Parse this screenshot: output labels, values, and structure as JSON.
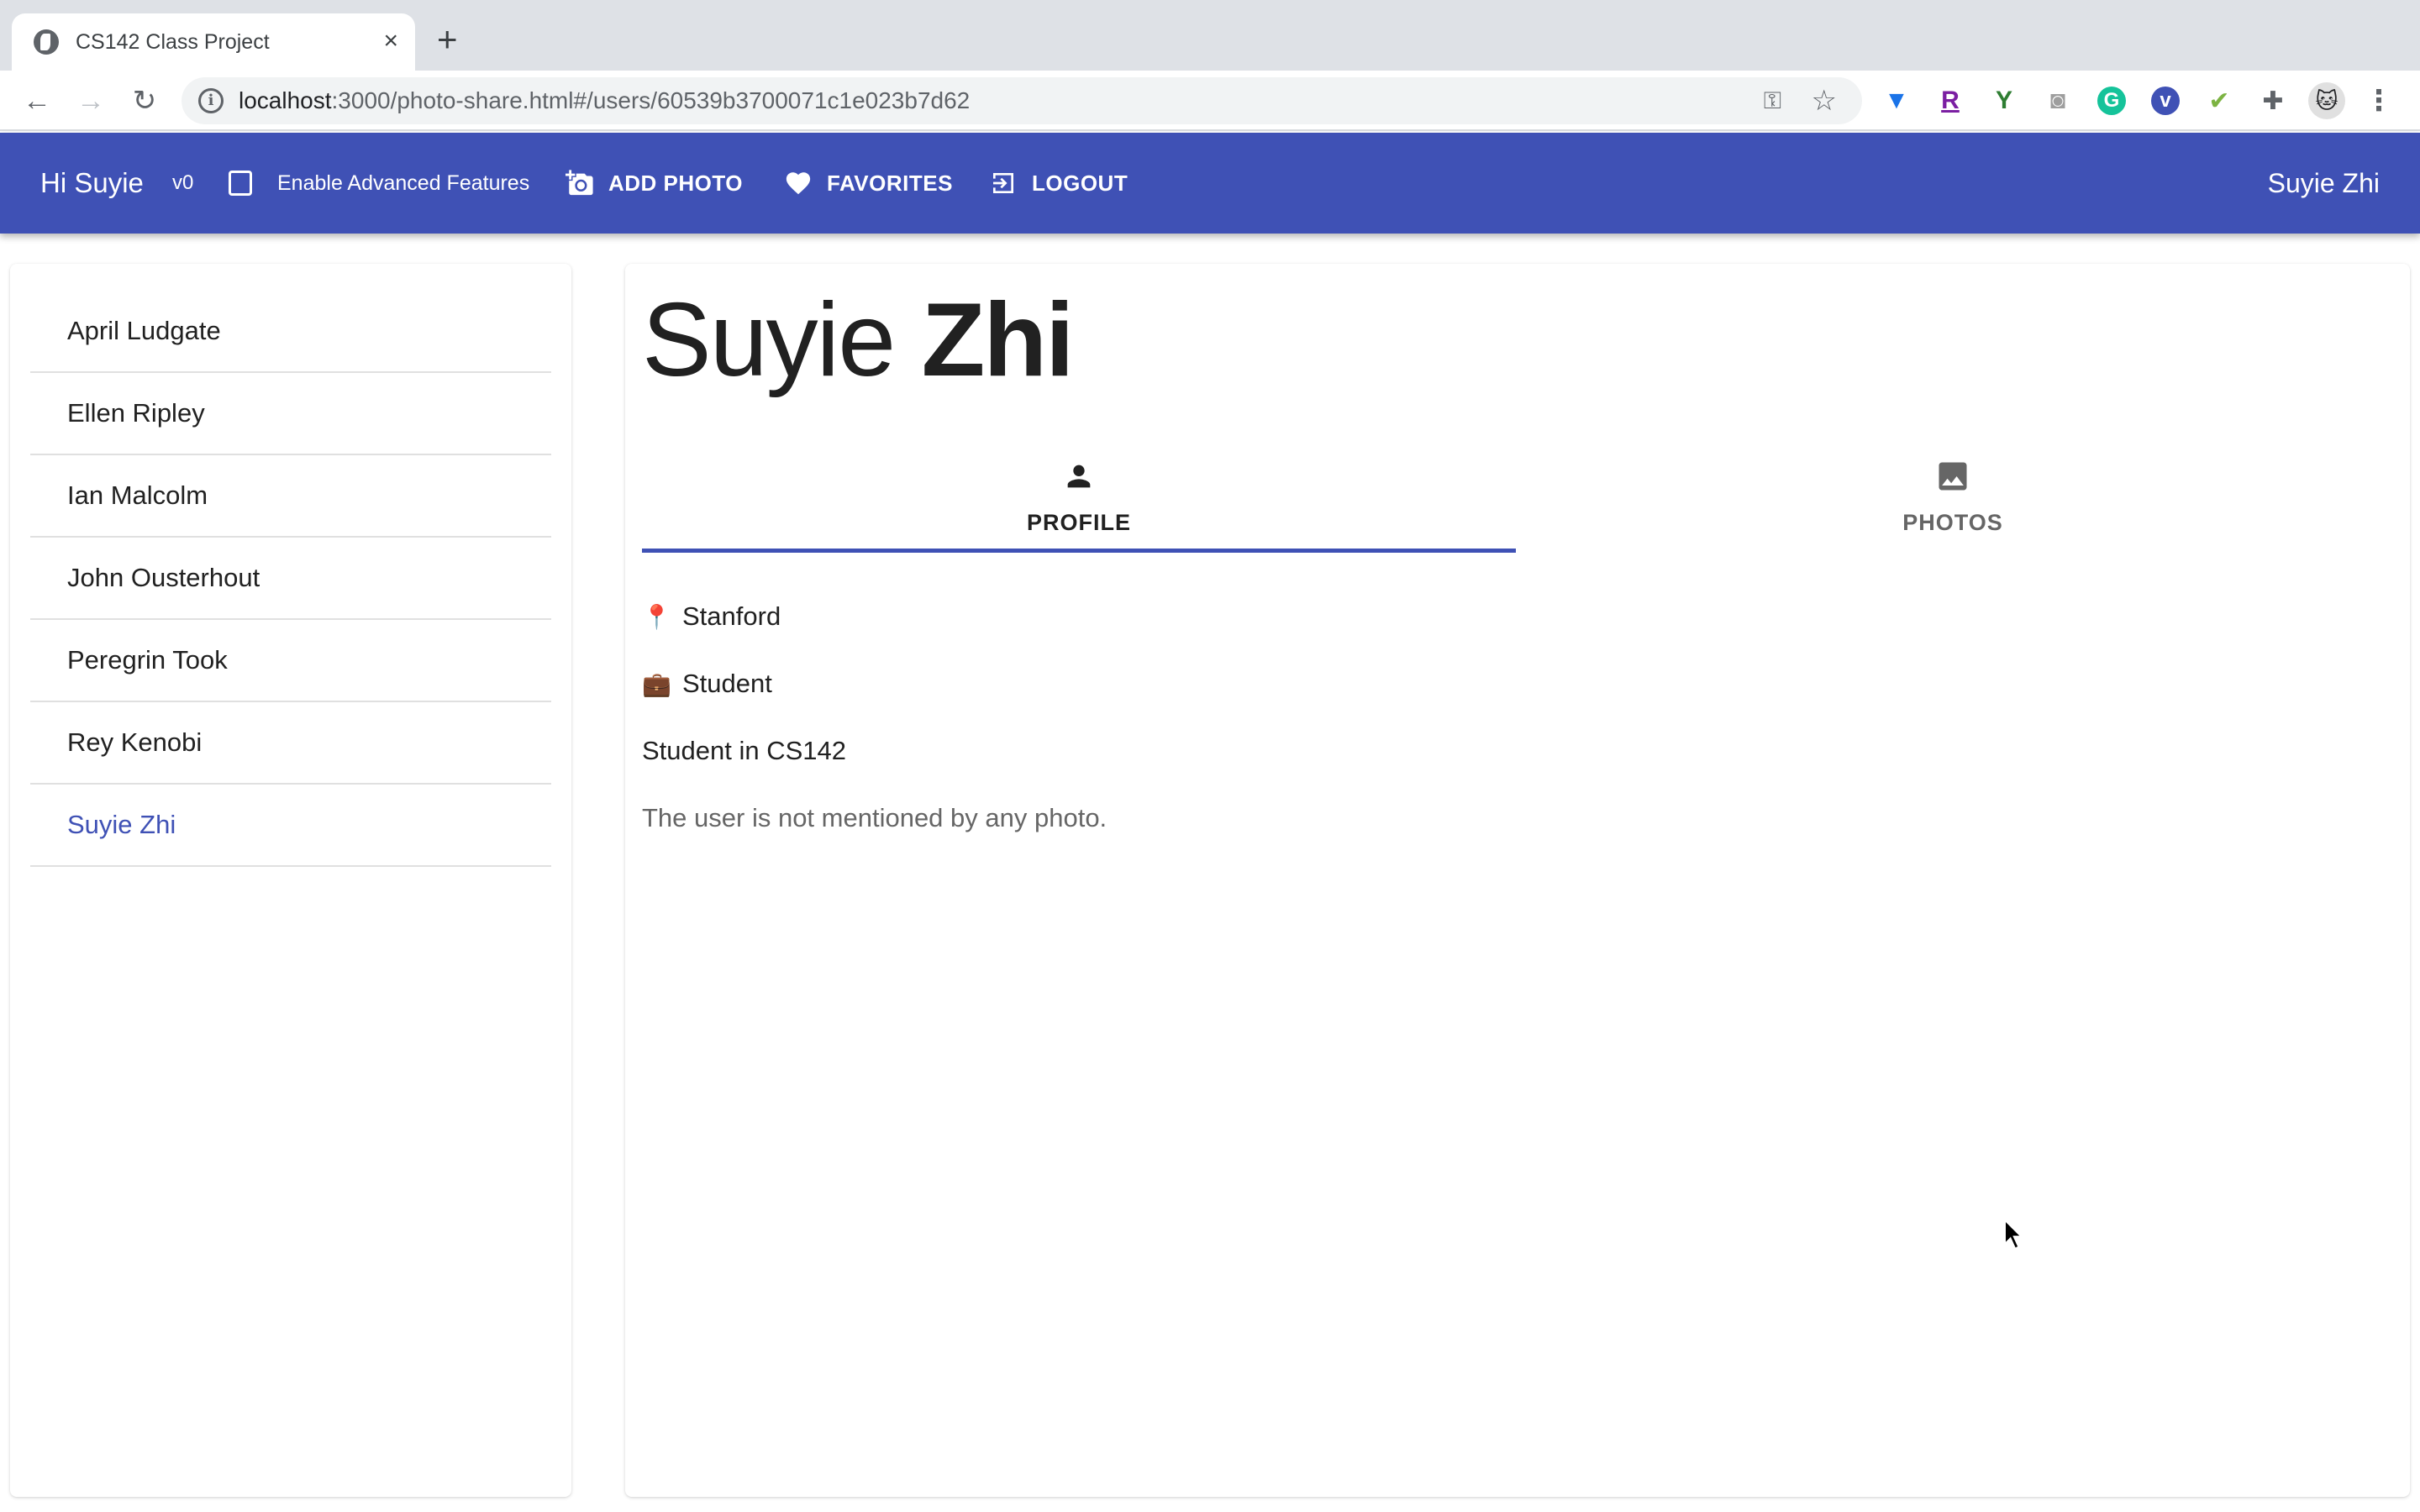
{
  "browser": {
    "tab_title": "CS142 Class Project",
    "tab_close": "×",
    "new_tab": "+",
    "url_host": "localhost",
    "url_rest": ":3000/photo-share.html#/users/60539b3700071c1e023b7d62",
    "back": "←",
    "forward": "→",
    "reload": "↻",
    "key_icon": "⚿",
    "star_icon": "☆",
    "menu": "⋮"
  },
  "appbar": {
    "greeting": "Hi Suyie",
    "version": "v0",
    "advanced_label": "Enable Advanced Features",
    "advanced_checked": false,
    "add_photo": "ADD PHOTO",
    "favorites": "FAVORITES",
    "logout": "LOGOUT",
    "current_user": "Suyie Zhi",
    "color": "#3f51b5"
  },
  "sidebar": {
    "users": [
      {
        "name": "April Ludgate",
        "selected": false
      },
      {
        "name": "Ellen Ripley",
        "selected": false
      },
      {
        "name": "Ian Malcolm",
        "selected": false
      },
      {
        "name": "John Ousterhout",
        "selected": false
      },
      {
        "name": "Peregrin Took",
        "selected": false
      },
      {
        "name": "Rey Kenobi",
        "selected": false
      },
      {
        "name": "Suyie Zhi",
        "selected": true
      }
    ]
  },
  "profile": {
    "first_name": "Suyie",
    "last_name": "Zhi",
    "tabs": [
      {
        "label": "PROFILE",
        "icon": "person-icon",
        "active": true
      },
      {
        "label": "PHOTOS",
        "icon": "image-icon",
        "active": false
      }
    ],
    "location_emoji": "📍",
    "location": "Stanford",
    "occupation_emoji": "💼",
    "occupation": "Student",
    "description": "Student in CS142",
    "mentions_message": "The user is not mentioned by any photo."
  }
}
